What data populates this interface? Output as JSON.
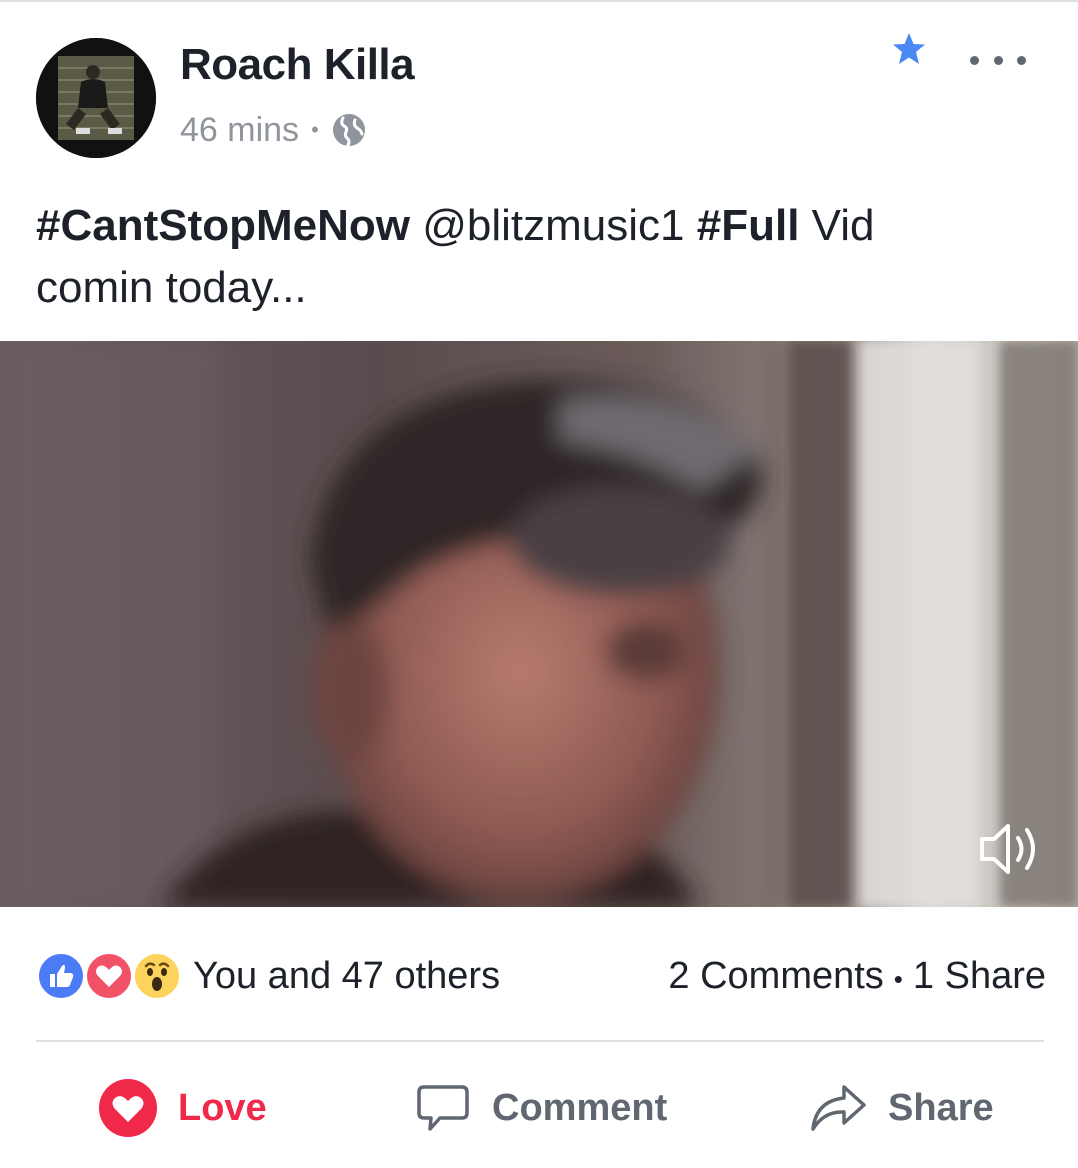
{
  "post": {
    "author": "Roach Killa",
    "timestamp": "46 mins",
    "separator": "•",
    "privacy_icon": "globe-icon",
    "text": {
      "hashtag1": "#CantStopMeNow",
      "mention": "@blitzmusic1",
      "hashtag2": "#Full",
      "rest_line1": "Vid",
      "rest_line2": "comin today..."
    },
    "favorite_icon": "star-icon",
    "menu_icon": "more-options-icon",
    "video": {
      "audio_icon": "speaker-icon"
    }
  },
  "reactions": {
    "types": [
      "like",
      "love",
      "wow"
    ],
    "summary": "You and 47 others",
    "comments": "2 Comments",
    "separator": "•",
    "shares": "1 Share"
  },
  "actions": {
    "love_label": "Love",
    "comment_label": "Comment",
    "share_label": "Share"
  },
  "colors": {
    "love": "#f0284a",
    "like_blue": "#4b7bf5",
    "star_blue": "#4a89f3",
    "secondary_text": "#90949c",
    "action_text": "#606770"
  }
}
